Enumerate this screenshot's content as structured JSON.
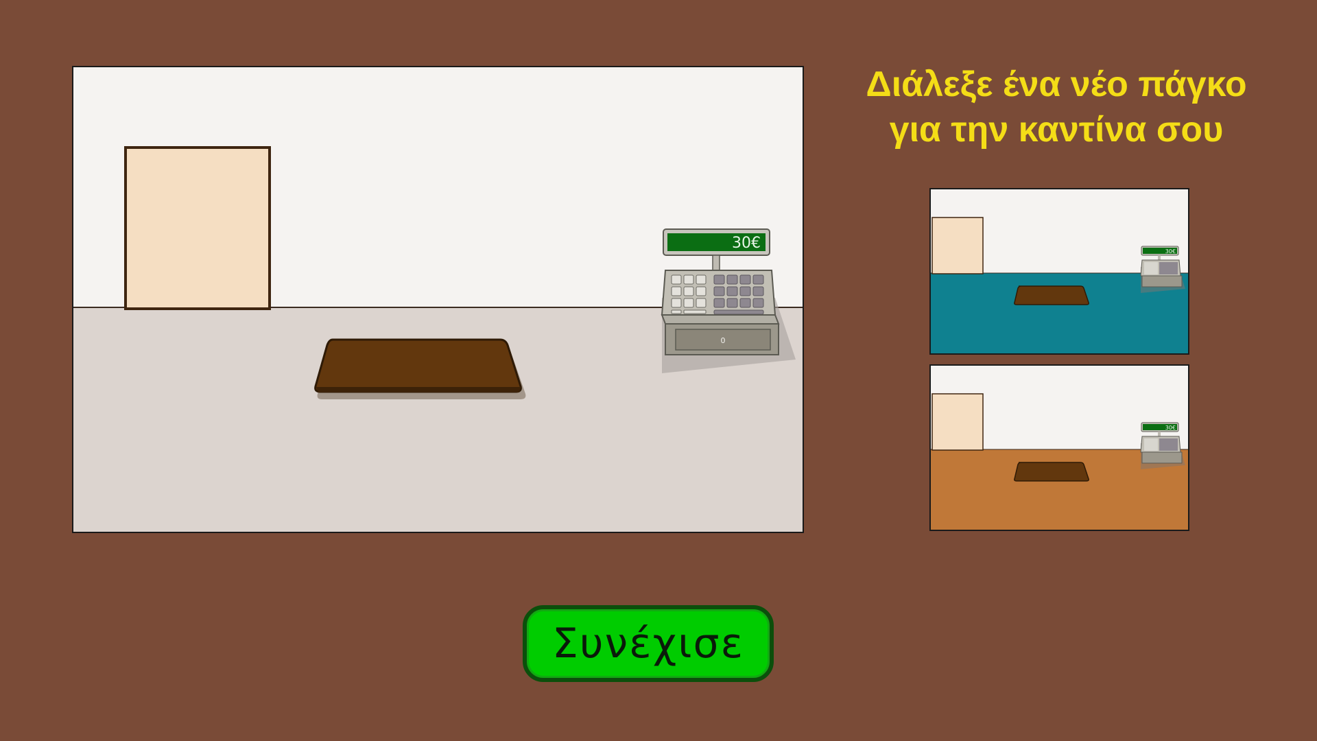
{
  "title": {
    "line1": "Διάλεξε ένα νέο πάγκο",
    "line2": "για την καντίνα σου"
  },
  "register": {
    "display": "30€",
    "drawer_label": "0"
  },
  "main_preview": {
    "floor_color": "#dcd4cf"
  },
  "options": [
    {
      "floor_color": "#0f8190",
      "display": "30€"
    },
    {
      "floor_color": "#c07838",
      "display": "30€"
    }
  ],
  "continue_button": {
    "label": "Συνέχισε"
  },
  "colors": {
    "background": "#7a4b37",
    "title": "#f4dd17",
    "button": "#00cc00",
    "counter": "#62370d",
    "door": "#f5dec2",
    "register_screen": "#0b6e13"
  }
}
